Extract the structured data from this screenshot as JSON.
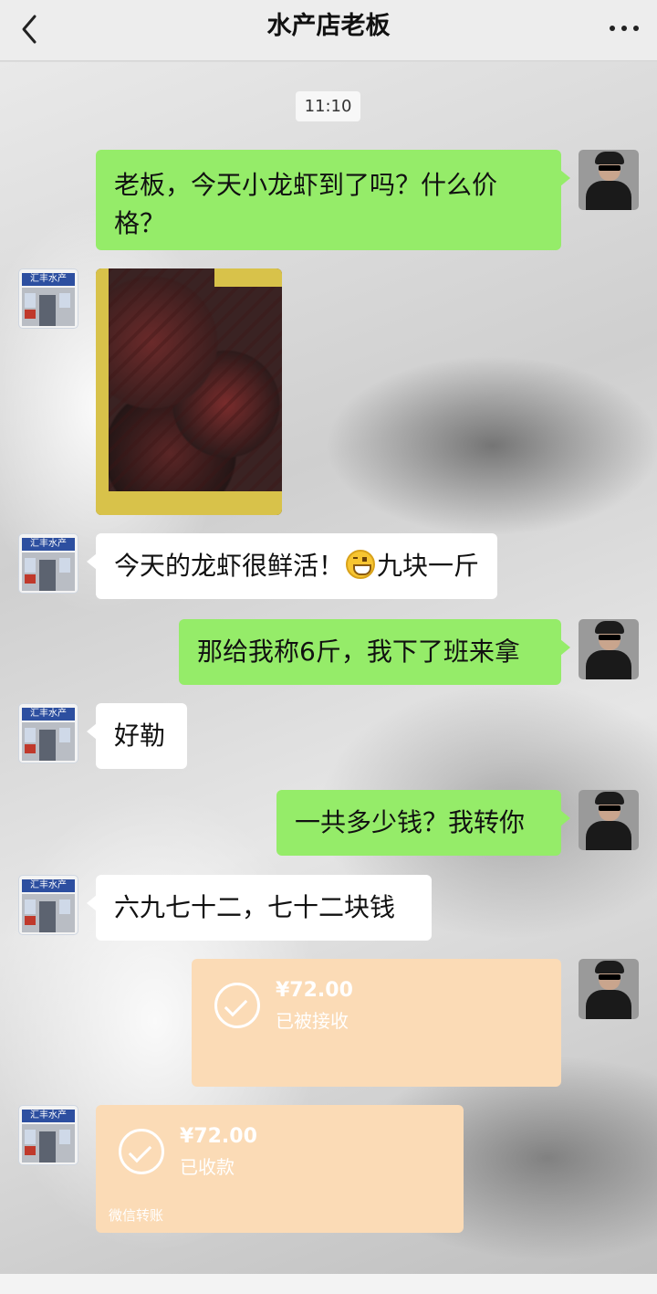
{
  "header": {
    "title": "水产店老板",
    "back_icon": "chevron-left-icon",
    "more_icon": "more-dots-icon"
  },
  "timestamp": "11:10",
  "messages": [
    {
      "from": "me",
      "text": "老板，今天小龙虾到了吗？什么价格？"
    },
    {
      "from": "shop",
      "type": "image",
      "description": "crayfish-photo"
    },
    {
      "from": "shop",
      "text_before": "今天的龙虾很鲜活！",
      "emoji": "grin-smiley-icon",
      "text_after": "九块一斤"
    },
    {
      "from": "me",
      "text": "那给我称6斤，我下了班来拿"
    },
    {
      "from": "shop",
      "text": "好勒"
    },
    {
      "from": "me",
      "text": "一共多少钱？我转你"
    },
    {
      "from": "shop",
      "text": "六九七十二，七十二块钱"
    },
    {
      "from": "me",
      "type": "transfer",
      "amount": "¥72.00",
      "status": "已被接收"
    },
    {
      "from": "shop",
      "type": "transfer",
      "amount": "¥72.00",
      "status": "已收款",
      "footer": "微信转账"
    }
  ],
  "shop_avatar_sign": "汇丰水产",
  "colors": {
    "my_bubble": "#95ec69",
    "other_bubble": "#ffffff",
    "transfer_card": "#fbdbb6",
    "header_bg": "#ededed"
  }
}
